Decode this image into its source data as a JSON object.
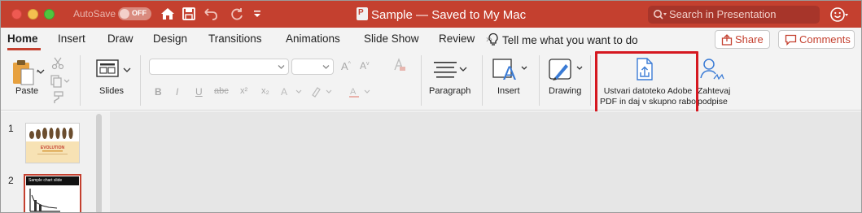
{
  "titlebar": {
    "autosave_label": "AutoSave",
    "autosave_state": "OFF",
    "document_title": "Sample — Saved to My Mac",
    "search_placeholder": "Search in Presentation",
    "accent_color": "#c4402f"
  },
  "tabs": {
    "items": [
      "Home",
      "Insert",
      "Draw",
      "Design",
      "Transitions",
      "Animations",
      "Slide Show",
      "Review"
    ],
    "active": "Home",
    "tell_me": "Tell me what you want to do"
  },
  "actions": {
    "share": "Share",
    "comments": "Comments"
  },
  "ribbon": {
    "paste": "Paste",
    "slides": "Slides",
    "paragraph": "Paragraph",
    "insert": "Insert",
    "drawing": "Drawing",
    "adobe_pdf": "Ustvari datoteko Adobe PDF in daj v skupno rabo",
    "request_signatures": "Zahtevaj podpise",
    "font_name_value": "",
    "font_size_value": "",
    "format_buttons": [
      "B",
      "I",
      "U",
      "abc",
      "x²",
      "x₂"
    ]
  },
  "thumbnails": [
    {
      "number": "1",
      "title": "EVOLUTION"
    },
    {
      "number": "2",
      "title": "Sample chart slide"
    }
  ]
}
